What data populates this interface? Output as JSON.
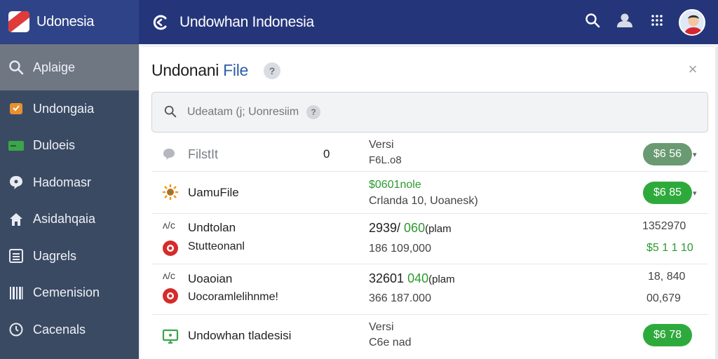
{
  "brand": {
    "title": "Udonesia"
  },
  "header": {
    "title": "Undowhan Indonesia"
  },
  "sidebar": {
    "items": [
      {
        "label": "Aplaige",
        "icon": "search-icon"
      },
      {
        "label": "Undongaia",
        "icon": "folder-icon"
      },
      {
        "label": "Duloeis",
        "icon": "card-icon"
      },
      {
        "label": "Hadomasr",
        "icon": "chat-icon"
      },
      {
        "label": "Asidahqaia",
        "icon": "home-icon"
      },
      {
        "label": "Uagrels",
        "icon": "list-icon"
      },
      {
        "label": "Cemenision",
        "icon": "barcode-icon"
      },
      {
        "label": "Cacenals",
        "icon": "clock-icon"
      }
    ]
  },
  "panel": {
    "title_main": "Undonani ",
    "title_accent": "File",
    "help": "?",
    "close": "×"
  },
  "search": {
    "placeholder": "Udeatam (j; Uonresiim",
    "help": "?"
  },
  "rows": [
    {
      "name": "FilstIt",
      "count": "0",
      "mid_top": "Versi",
      "mid_bottom": "F6L.o8",
      "pill": "$6 56"
    },
    {
      "name": "UamuFile",
      "mid_top": "$0601nole",
      "mid_bottom": "Crlanda 10, Uoanesk)",
      "pill": "$6 85"
    },
    {
      "name_top": "Undtolan",
      "name_bottom": "Stutteonanl",
      "mid_top_a": "2939/ ",
      "mid_top_b": "060",
      "mid_top_c": "(plam",
      "mid_bottom": "186 109,000",
      "right_top": "1352970",
      "right_bottom": "$5 1 1 10"
    },
    {
      "name_top": "Uoaoian",
      "name_bottom": "Uocoramlelihnme!",
      "mid_top_a": "32601 ",
      "mid_top_b": "040",
      "mid_top_c": "(plam",
      "mid_bottom": "366 187.000",
      "right_top": "18, 840",
      "right_bottom": "00,679"
    },
    {
      "name": "Undowhan tladesisi",
      "mid_top": "Versi",
      "mid_bottom": "C6e nad",
      "pill": "$6 78"
    }
  ],
  "colors": {
    "header": "#25357a",
    "sidebar": "#3b4a63",
    "accent_green": "#2eaa3c"
  }
}
